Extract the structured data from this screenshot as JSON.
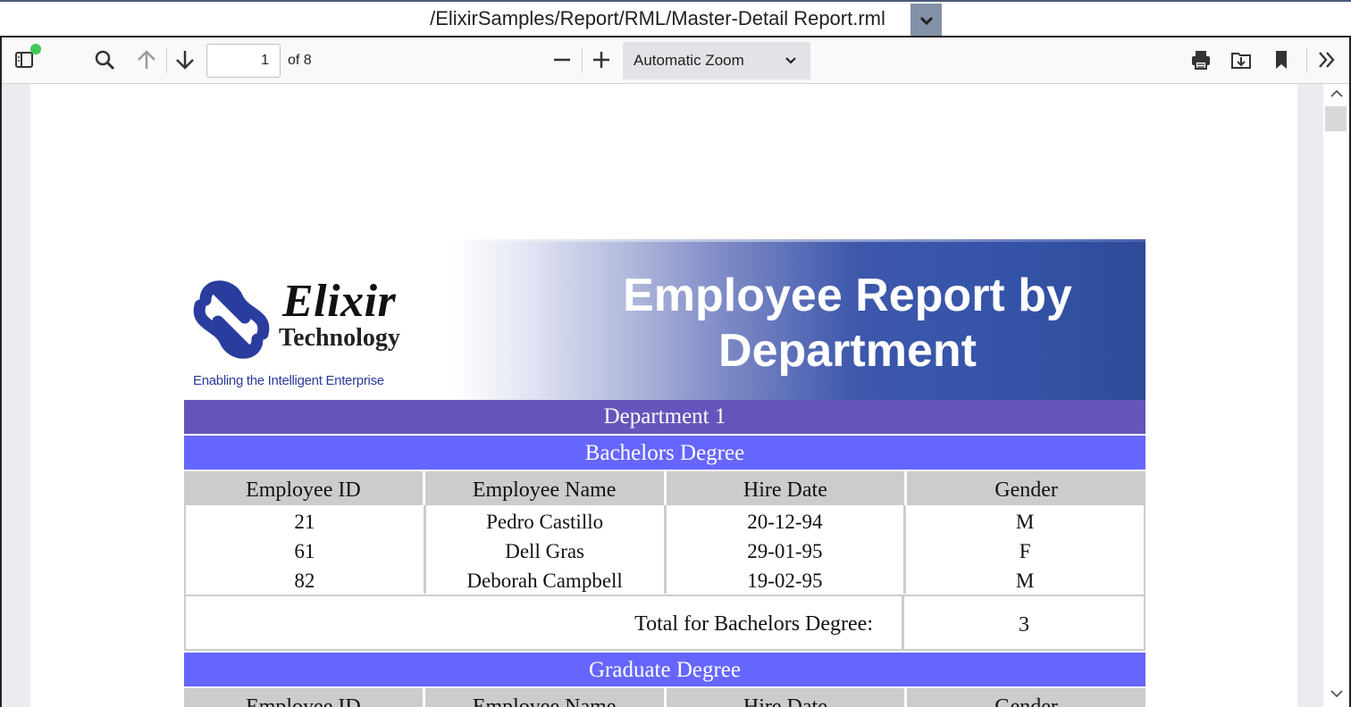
{
  "window": {
    "title": "/ElixirSamples/Report/RML/Master-Detail Report.rml"
  },
  "toolbar": {
    "page_number": "1",
    "page_count_label": "of 8",
    "zoom_label": "Automatic Zoom"
  },
  "report": {
    "logo": {
      "word": "Elixir",
      "sub": "Technology",
      "tagline": "Enabling the Intelligent Enterprise"
    },
    "title": "Employee Report by Department",
    "department": "Department 1",
    "sections": [
      {
        "degree": "Bachelors Degree",
        "columns": [
          "Employee ID",
          "Employee Name",
          "Hire Date",
          "Gender"
        ],
        "rows": [
          [
            "21",
            "Pedro Castillo",
            "20-12-94",
            "M"
          ],
          [
            "61",
            "Dell Gras",
            "29-01-95",
            "F"
          ],
          [
            "82",
            "Deborah Campbell",
            "19-02-95",
            "M"
          ]
        ],
        "total_label": "Total for Bachelors Degree:",
        "total_value": "3"
      },
      {
        "degree": "Graduate Degree",
        "columns": [
          "Employee ID",
          "Employee Name",
          "Hire Date",
          "Gender"
        ]
      }
    ]
  },
  "colors": {
    "department_band": "#6555bb",
    "degree_band": "#6666ff",
    "header_cell": "#cccccc",
    "status_dot": "#41c75a"
  }
}
